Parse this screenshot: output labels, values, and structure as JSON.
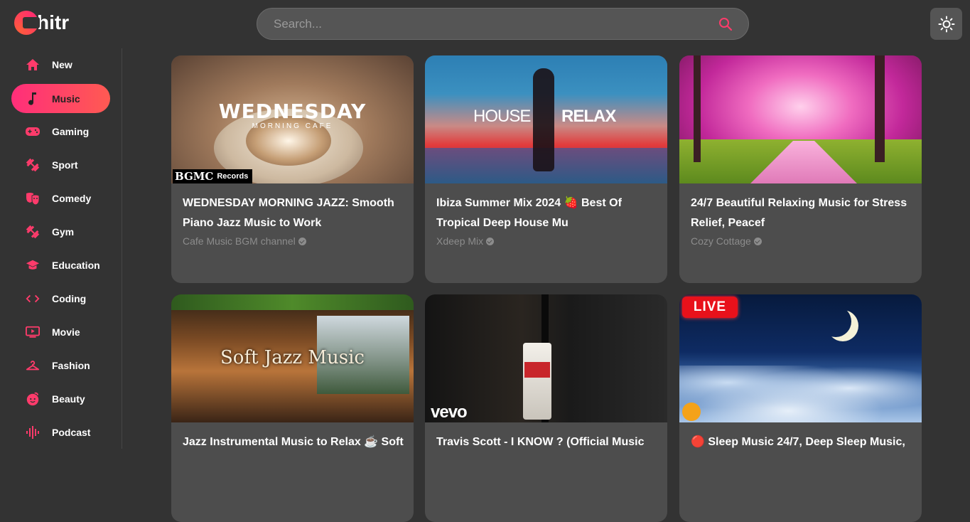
{
  "app": {
    "logo_text": "hitr"
  },
  "search": {
    "placeholder": "Search..."
  },
  "sidebar": {
    "items": [
      {
        "label": "New",
        "icon": "home-icon",
        "active": false
      },
      {
        "label": "Music",
        "icon": "music-note-icon",
        "active": true
      },
      {
        "label": "Gaming",
        "icon": "gamepad-icon",
        "active": false
      },
      {
        "label": "Sport",
        "icon": "dumbbell-icon",
        "active": false
      },
      {
        "label": "Comedy",
        "icon": "theater-masks-icon",
        "active": false
      },
      {
        "label": "Gym",
        "icon": "dumbbell-icon",
        "active": false
      },
      {
        "label": "Education",
        "icon": "graduation-cap-icon",
        "active": false
      },
      {
        "label": "Coding",
        "icon": "code-icon",
        "active": false
      },
      {
        "label": "Movie",
        "icon": "tv-play-icon",
        "active": false
      },
      {
        "label": "Fashion",
        "icon": "hanger-icon",
        "active": false
      },
      {
        "label": "Beauty",
        "icon": "face-icon",
        "active": false
      },
      {
        "label": "Podcast",
        "icon": "audio-waveform-icon",
        "active": false
      }
    ]
  },
  "videos": [
    {
      "title": "WEDNESDAY MORNING JAZZ: Smooth Piano Jazz Music to Work",
      "channel": "Cafe Music BGM channel",
      "thumb_title": "WEDNESDAY",
      "thumb_subtitle": "MORNING CAFE",
      "thumb_badge_logo": "BGMC",
      "thumb_badge": "Records"
    },
    {
      "title": "Ibiza Summer Mix 2024 🍓 Best Of Tropical Deep House Mu",
      "channel": "Xdeep Mix",
      "thumb_left": "HOUSE",
      "thumb_right": "RELAX"
    },
    {
      "title": "24/7 Beautiful Relaxing Music for Stress Relief, Peacef",
      "channel": "Cozy Cottage"
    },
    {
      "title": "Jazz Instrumental Music to Relax ☕ Soft",
      "thumb_title": "Soft Jazz Music"
    },
    {
      "title": "Travis Scott - I KNOW ? (Official Music",
      "thumb_badge": "vevo"
    },
    {
      "title": "🔴 Sleep Music 24/7, Deep Sleep Music,",
      "thumb_badge": "LIVE"
    }
  ],
  "colors": {
    "accent_start": "#ff2e7a",
    "accent_end": "#ff5a52",
    "icon": "#ff3b6b",
    "background": "#333333",
    "card": "#4d4d4d"
  }
}
